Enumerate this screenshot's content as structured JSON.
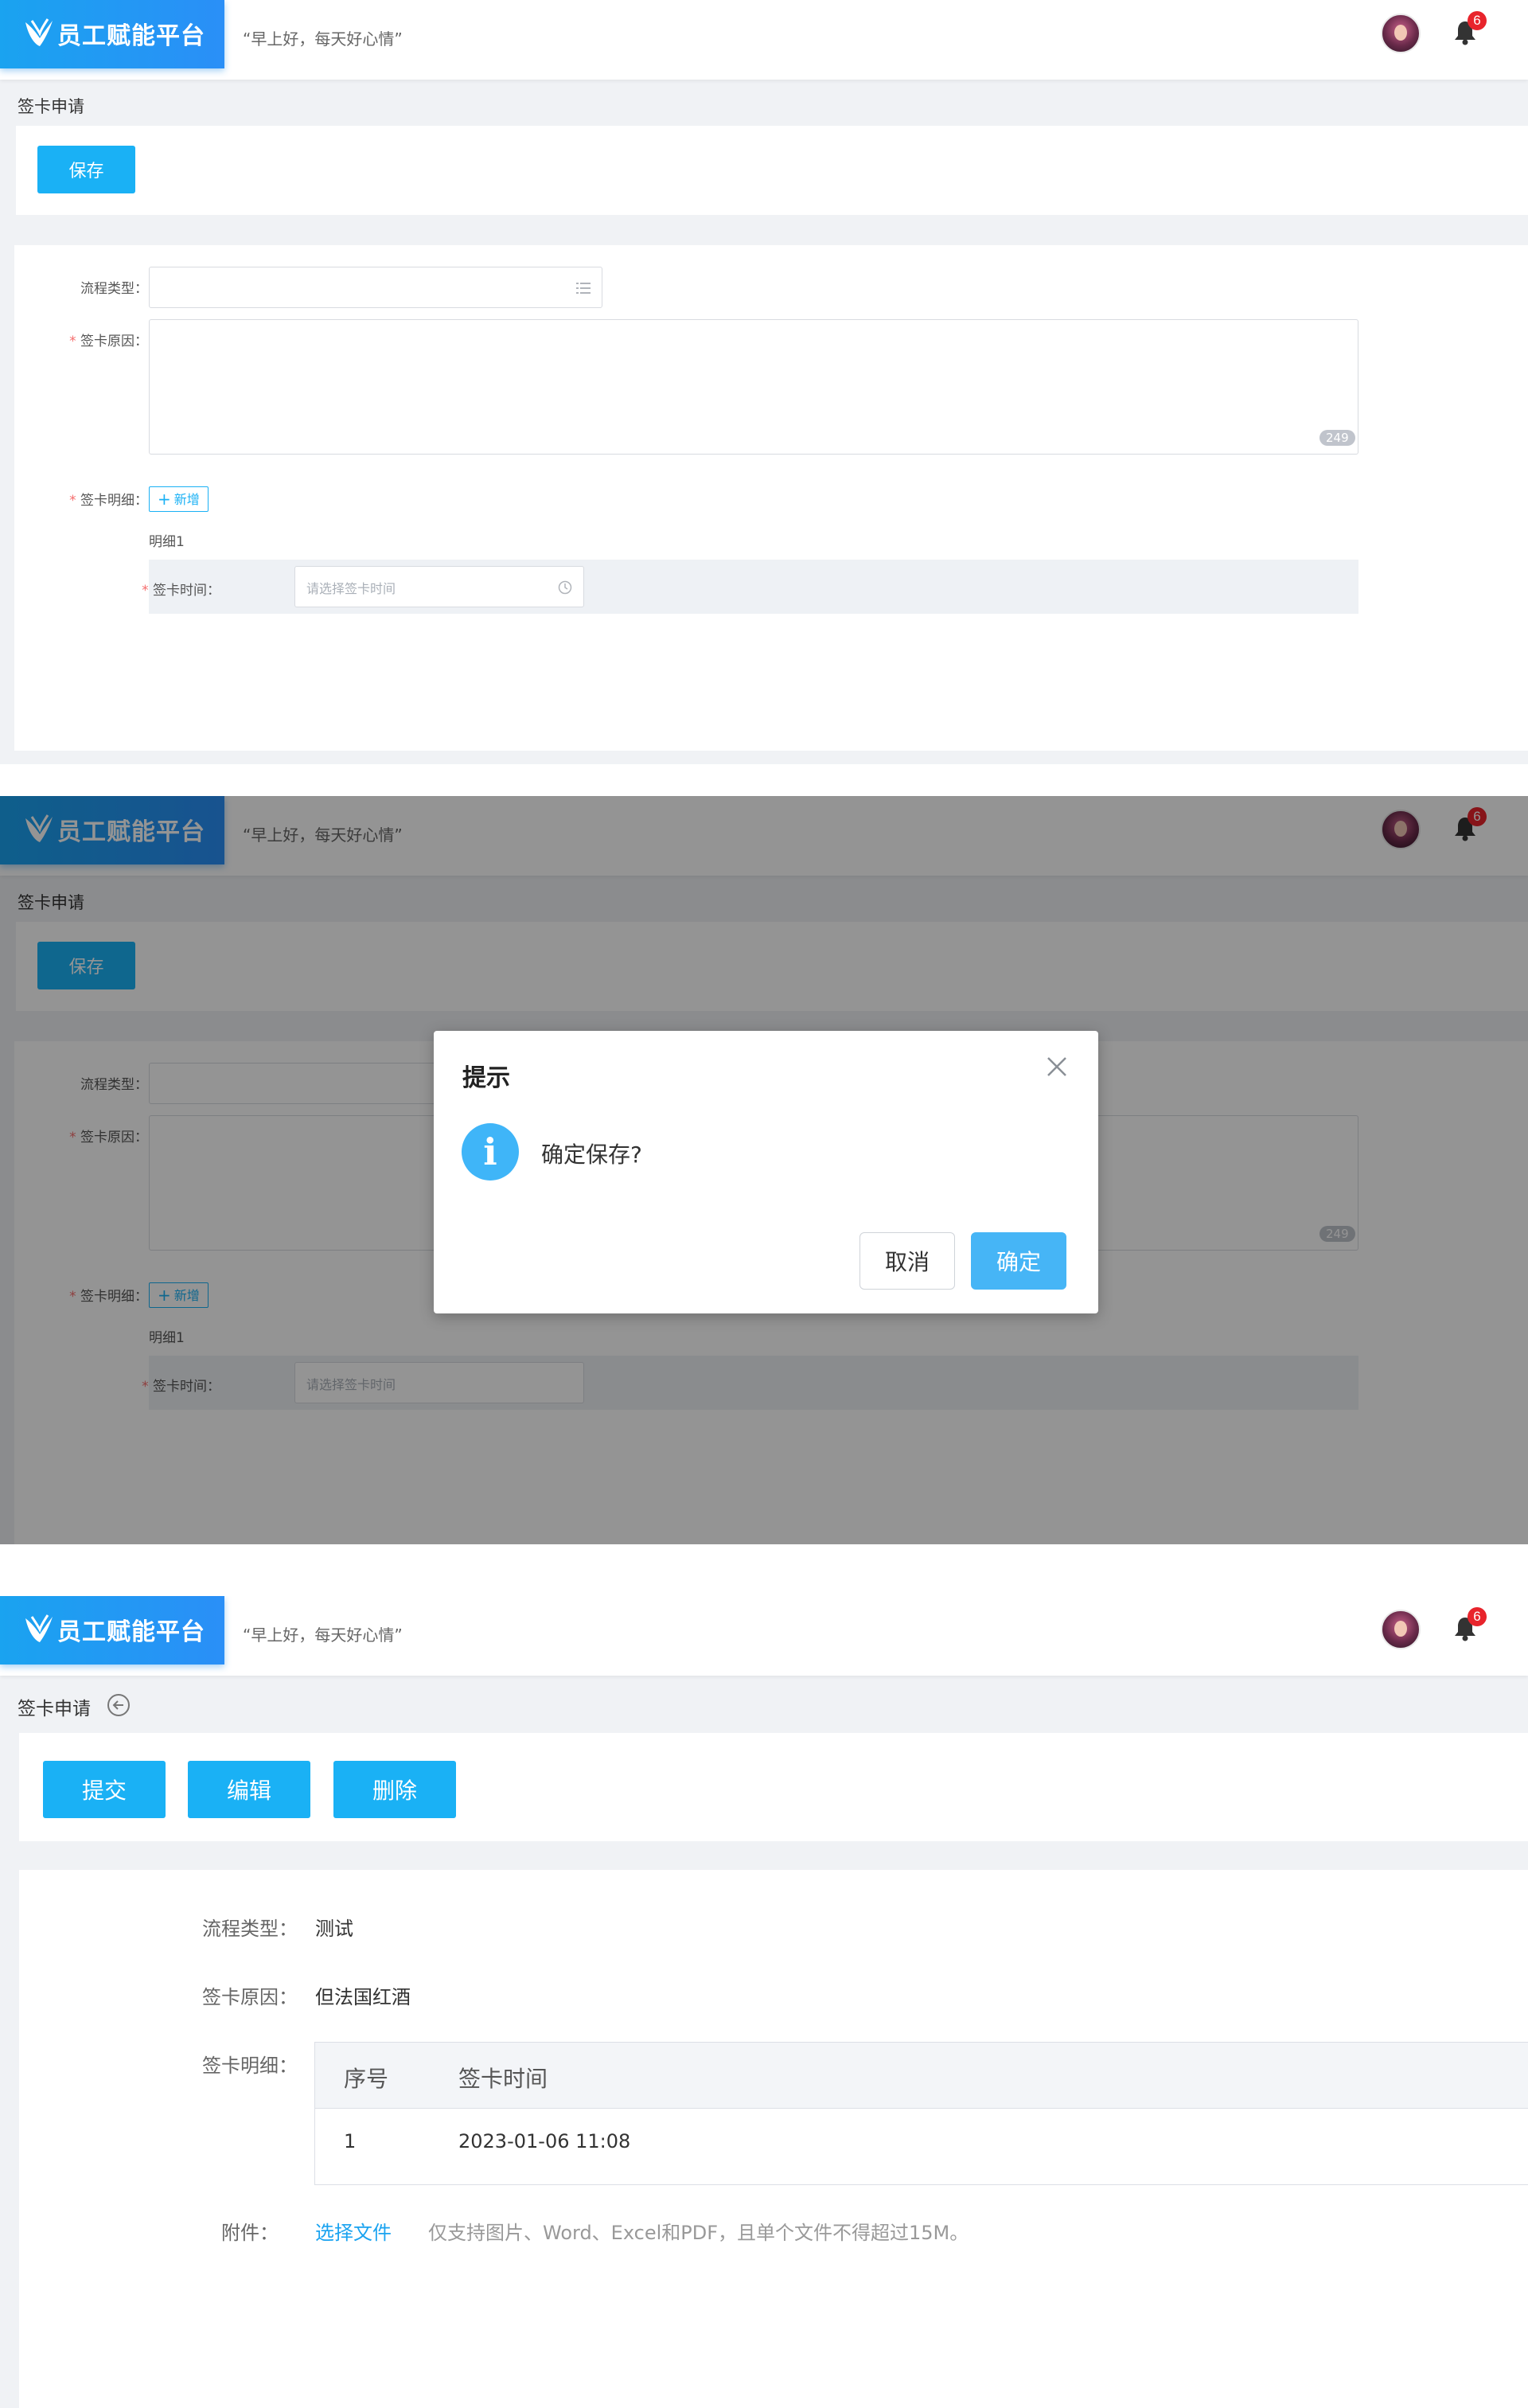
{
  "header": {
    "logo_text": "员工赋能平台",
    "greeting": "“早上好，每天好心情”",
    "notification_count": "6"
  },
  "form_page": {
    "breadcrumb": "签卡申请",
    "save_label": "保存",
    "flow_type_label": "流程类型：",
    "reason_label": "签卡原因：",
    "reason_counter": "249",
    "detail_label": "签卡明细：",
    "add_label": "新增",
    "detail_title": "明细1",
    "time_label": "签卡时间：",
    "time_placeholder": "请选择签卡时间"
  },
  "dialog": {
    "title": "提示",
    "message": "确定保存?",
    "cancel_label": "取消",
    "ok_label": "确定"
  },
  "view_page": {
    "breadcrumb": "签卡申请",
    "submit_label": "提交",
    "edit_label": "编辑",
    "delete_label": "删除",
    "flow_type_label": "流程类型：",
    "flow_type_value": "测试",
    "reason_label": "签卡原因：",
    "reason_value": "但法国红酒",
    "detail_label": "签卡明细：",
    "table": {
      "headers": [
        "序号",
        "签卡时间"
      ],
      "rows": [
        [
          "1",
          "2023-01-06 11:08"
        ]
      ]
    },
    "attachment_label": "附件：",
    "choose_file_label": "选择文件",
    "attachment_hint": "仅支持图片、Word、Excel和PDF，且单个文件不得超过15M。"
  },
  "colors": {
    "primary": "#1ab1f5",
    "required": "#f56c6c",
    "badge": "#e8242c"
  },
  "icons": [
    "logo-mark-icon",
    "bell-icon",
    "list-icon",
    "clock-icon",
    "close-icon",
    "info-icon",
    "back-arrow-icon",
    "plus-icon"
  ]
}
